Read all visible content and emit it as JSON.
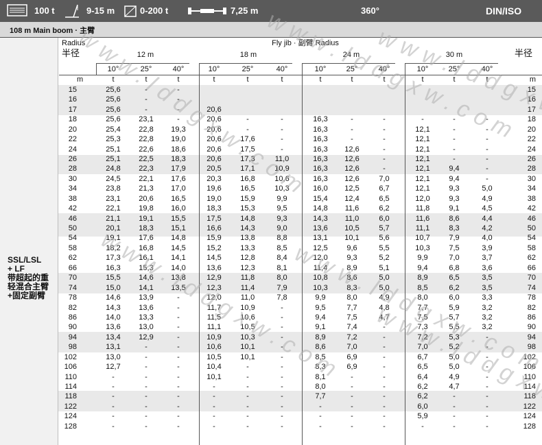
{
  "header": {
    "capacity": "100 t",
    "radius_range": "9-15 m",
    "counterweight": "0-200 t",
    "track_width": "7,25 m",
    "slew": "360°",
    "standard": "DIN/ISO"
  },
  "subheader": {
    "text": "108 m  Main boom · 主臂"
  },
  "table_head": {
    "radius_en": "Radius",
    "radius_cn": "半径",
    "fly_jib": "Fly jib ·  副臂 Radius",
    "jib_lengths": [
      "12 m",
      "18 m",
      "24 m",
      "30 m"
    ],
    "angles": [
      "10°",
      "25°",
      "40°"
    ],
    "unit_m": "m",
    "unit_t": "t"
  },
  "left_label": {
    "lines": [
      "SSL/LSL",
      "+ LF",
      "带超起的重",
      "轻混合主臂",
      "+固定副臂"
    ]
  },
  "rows": [
    [
      "15",
      "25,6",
      "-",
      "-",
      "",
      "",
      "",
      "",
      "",
      "",
      "",
      "",
      ""
    ],
    [
      "16",
      "25,6",
      "-",
      "-",
      "",
      "",
      "",
      "",
      "",
      "",
      "",
      "",
      ""
    ],
    [
      "17",
      "25,6",
      "-",
      "-",
      "20,6",
      "",
      "",
      "",
      "",
      "",
      "",
      "",
      ""
    ],
    [
      "18",
      "25,6",
      "23,1",
      "-",
      "20,6",
      "-",
      "-",
      "16,3",
      "-",
      "-",
      "-",
      "-",
      "-"
    ],
    [
      "20",
      "25,4",
      "22,8",
      "19,3",
      "20,6",
      "-",
      "-",
      "16,3",
      "-",
      "-",
      "12,1",
      "-",
      "-"
    ],
    [
      "22",
      "25,3",
      "22,8",
      "19,0",
      "20,6",
      "17,6",
      "-",
      "16,3",
      "-",
      "-",
      "12,1",
      "-",
      "-"
    ],
    [
      "24",
      "25,1",
      "22,6",
      "18,6",
      "20,6",
      "17,5",
      "-",
      "16,3",
      "12,6",
      "-",
      "12,1",
      "-",
      "-"
    ],
    [
      "26",
      "25,1",
      "22,5",
      "18,3",
      "20,6",
      "17,3",
      "11,0",
      "16,3",
      "12,6",
      "-",
      "12,1",
      "-",
      "-"
    ],
    [
      "28",
      "24,8",
      "22,3",
      "17,9",
      "20,5",
      "17,1",
      "10,9",
      "16,3",
      "12,6",
      "-",
      "12,1",
      "9,4",
      "-"
    ],
    [
      "30",
      "24,5",
      "22,1",
      "17,6",
      "20,3",
      "16,8",
      "10,6",
      "16,3",
      "12,6",
      "7,0",
      "12,1",
      "9,4",
      "-"
    ],
    [
      "34",
      "23,8",
      "21,3",
      "17,0",
      "19,6",
      "16,5",
      "10,3",
      "16,0",
      "12,5",
      "6,7",
      "12,1",
      "9,3",
      "5,0"
    ],
    [
      "38",
      "23,1",
      "20,6",
      "16,5",
      "19,0",
      "15,9",
      "9,9",
      "15,4",
      "12,4",
      "6,5",
      "12,0",
      "9,3",
      "4,9"
    ],
    [
      "42",
      "22,1",
      "19,8",
      "16,0",
      "18,3",
      "15,3",
      "9,5",
      "14,8",
      "11,6",
      "6,2",
      "11,8",
      "9,1",
      "4,5"
    ],
    [
      "46",
      "21,1",
      "19,1",
      "15,5",
      "17,5",
      "14,8",
      "9,3",
      "14,3",
      "11,0",
      "6,0",
      "11,6",
      "8,6",
      "4,4"
    ],
    [
      "50",
      "20,1",
      "18,3",
      "15,1",
      "16,6",
      "14,3",
      "9,0",
      "13,6",
      "10,5",
      "5,7",
      "11,1",
      "8,3",
      "4,2"
    ],
    [
      "54",
      "19,1",
      "17,6",
      "14,8",
      "15,9",
      "13,8",
      "8,8",
      "13,1",
      "10,1",
      "5,6",
      "10,7",
      "7,9",
      "4,0"
    ],
    [
      "58",
      "18,2",
      "16,8",
      "14,5",
      "15,2",
      "13,3",
      "8,5",
      "12,5",
      "9,6",
      "5,5",
      "10,3",
      "7,5",
      "3,9"
    ],
    [
      "62",
      "17,3",
      "16,1",
      "14,1",
      "14,5",
      "12,8",
      "8,4",
      "12,0",
      "9,3",
      "5,2",
      "9,9",
      "7,0",
      "3,7"
    ],
    [
      "66",
      "16,3",
      "15,3",
      "14,0",
      "13,6",
      "12,3",
      "8,1",
      "11,4",
      "8,9",
      "5,1",
      "9,4",
      "6,8",
      "3,6"
    ],
    [
      "70",
      "15,5",
      "14,6",
      "13,8",
      "12,9",
      "11,8",
      "8,0",
      "10,8",
      "8,6",
      "5,0",
      "8,9",
      "6,5",
      "3,5"
    ],
    [
      "74",
      "15,0",
      "14,1",
      "13,5",
      "12,3",
      "11,4",
      "7,9",
      "10,3",
      "8,3",
      "5,0",
      "8,5",
      "6,2",
      "3,5"
    ],
    [
      "78",
      "14,6",
      "13,9",
      "-",
      "12,0",
      "11,0",
      "7,8",
      "9,9",
      "8,0",
      "4,9",
      "8,0",
      "6,0",
      "3,3"
    ],
    [
      "82",
      "14,3",
      "13,6",
      "-",
      "11,7",
      "10,9",
      "-",
      "9,5",
      "7,7",
      "4,8",
      "7,7",
      "5,9",
      "3,2"
    ],
    [
      "86",
      "14,0",
      "13,3",
      "-",
      "11,5",
      "10,6",
      "-",
      "9,4",
      "7,5",
      "4,7",
      "7,5",
      "5,7",
      "3,2"
    ],
    [
      "90",
      "13,6",
      "13,0",
      "-",
      "11,1",
      "10,5",
      "-",
      "9,1",
      "7,4",
      "-",
      "7,3",
      "5,5",
      "3,2"
    ],
    [
      "94",
      "13,4",
      "12,9",
      "-",
      "10,9",
      "10,3",
      "-",
      "8,9",
      "7,2",
      "-",
      "7,2",
      "5,3",
      "-"
    ],
    [
      "98",
      "13,1",
      "-",
      "-",
      "10,6",
      "10,1",
      "-",
      "8,6",
      "7,0",
      "-",
      "7,0",
      "5,2",
      "-"
    ],
    [
      "102",
      "13,0",
      "-",
      "-",
      "10,5",
      "10,1",
      "-",
      "8,5",
      "6,9",
      "-",
      "6,7",
      "5,0",
      "-"
    ],
    [
      "106",
      "12,7",
      "-",
      "-",
      "10,4",
      "-",
      "-",
      "8,3",
      "6,9",
      "-",
      "6,5",
      "5,0",
      "-"
    ],
    [
      "110",
      "-",
      "-",
      "-",
      "10,1",
      "-",
      "-",
      "8,1",
      "-",
      "-",
      "6,4",
      "4,9",
      "-"
    ],
    [
      "114",
      "-",
      "-",
      "-",
      "-",
      "-",
      "-",
      "8,0",
      "-",
      "-",
      "6,2",
      "4,7",
      "-"
    ],
    [
      "118",
      "-",
      "-",
      "-",
      "-",
      "-",
      "-",
      "7,7",
      "-",
      "-",
      "6,2",
      "-",
      "-"
    ],
    [
      "122",
      "-",
      "-",
      "-",
      "-",
      "-",
      "-",
      "-",
      "-",
      "-",
      "6,0",
      "-",
      "-"
    ],
    [
      "124",
      "-",
      "-",
      "-",
      "-",
      "-",
      "-",
      "-",
      "-",
      "-",
      "5,9",
      "-",
      "-"
    ],
    [
      "128",
      "-",
      "-",
      "-",
      "-",
      "-",
      "-",
      "-",
      "-",
      "-",
      "-",
      "-",
      "-"
    ]
  ],
  "watermarks": [
    "www.lddgxw.com",
    "www.lddgxw.com",
    "www.lddgxw.com",
    "www.lddgxw.com",
    "www.lddgxw.com",
    "www.lddgxw.com"
  ]
}
